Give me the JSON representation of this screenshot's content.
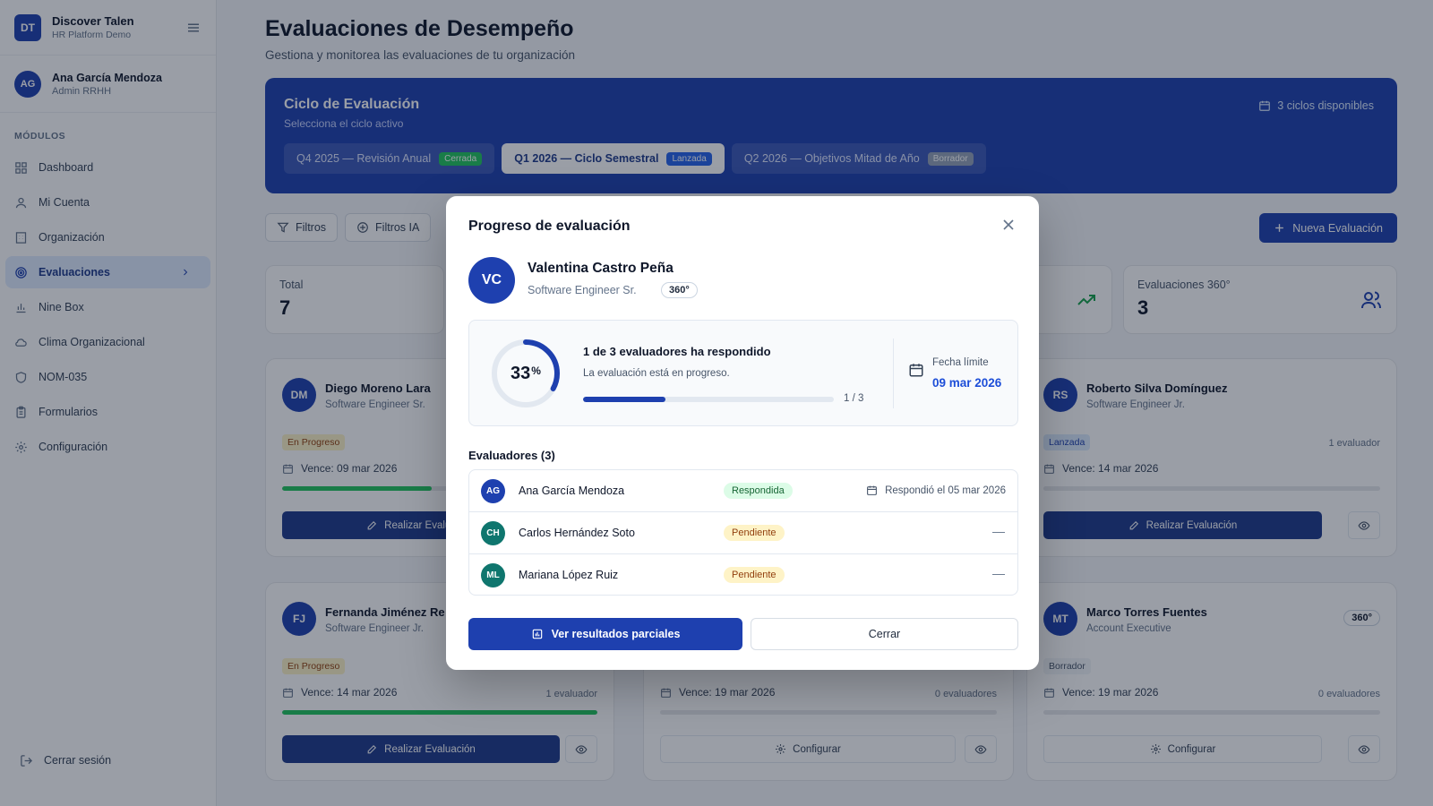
{
  "sidebar": {
    "brand_initials": "DT",
    "brand_name": "Discover Talen",
    "brand_sub": "HR Platform Demo",
    "user_initials": "AG",
    "user_name": "Ana García Mendoza",
    "user_role": "Admin RRHH",
    "modules_title": "MÓDULOS",
    "items": [
      {
        "label": "Dashboard",
        "icon": "dashboard-icon"
      },
      {
        "label": "Mi Cuenta",
        "icon": "user-icon"
      },
      {
        "label": "Organización",
        "icon": "building-icon"
      },
      {
        "label": "Evaluaciones",
        "icon": "target-icon",
        "active": true
      },
      {
        "label": "Nine Box",
        "icon": "bar-chart-icon"
      },
      {
        "label": "Clima Organizacional",
        "icon": "cloud-icon"
      },
      {
        "label": "NOM-035",
        "icon": "shield-icon"
      },
      {
        "label": "Formularios",
        "icon": "clipboard-icon"
      },
      {
        "label": "Configuración",
        "icon": "gear-icon"
      }
    ],
    "logout": "Cerrar sesión"
  },
  "page": {
    "title": "Evaluaciones de Desempeño",
    "subtitle": "Gestiona y monitorea las evaluaciones de tu organización"
  },
  "cycle": {
    "title": "Ciclo de Evaluación",
    "subtitle": "Selecciona el ciclo activo",
    "count": "3 ciclos disponibles",
    "tabs": [
      {
        "label": "Q4 2025 — Revisión Anual",
        "tag": "Cerrada"
      },
      {
        "label": "Q1 2026 — Ciclo Semestral",
        "tag": "Lanzada"
      },
      {
        "label": "Q2 2026 — Objetivos Mitad de Año",
        "tag": "Borrador"
      }
    ]
  },
  "toolbar": {
    "filters": "Filtros",
    "ai_filters": "Filtros IA",
    "new_eval": "Nueva Evaluación"
  },
  "stats": {
    "total_label": "Total",
    "total_value": "7",
    "e360_label": "Evaluaciones 360°",
    "e360_value": "3"
  },
  "cards": [
    {
      "initials": "DM",
      "name": "Diego Moreno Lara",
      "role": "Software Engineer Sr.",
      "badge": "En Progreso",
      "due": "Vence: 09 mar 2026",
      "action": "Realizar Evaluación",
      "progress": 0.5
    },
    {
      "initials": "RS",
      "name": "Roberto Silva Domínguez",
      "role": "Software Engineer Jr.",
      "badge": "Lanzada",
      "evaluators": "1 evaluador",
      "due": "Vence: 14 mar 2026",
      "action": "Realizar Evaluación",
      "progress": 0
    },
    {
      "initials": "FJ",
      "name": "Fernanda Jiménez Re",
      "role": "Software Engineer Jr.",
      "badge": "En Progreso",
      "evaluators": "1 evaluador",
      "due": "Vence: 14 mar 2026",
      "action": "Realizar Evaluación",
      "progress": 1
    },
    {
      "evaluators": "0 evaluadores",
      "due": "Vence: 19 mar 2026",
      "action": "Configurar",
      "progress": 0
    },
    {
      "initials": "MT",
      "name": "Marco Torres Fuentes",
      "role": "Account Executive",
      "badge": "Borrador",
      "pill": "360°",
      "evaluators": "0 evaluadores",
      "due": "Vence: 19 mar 2026",
      "action": "Configurar",
      "progress": 0
    }
  ],
  "modal": {
    "title": "Progreso de evaluación",
    "initials": "VC",
    "name": "Valentina Castro Peña",
    "role": "Software Engineer Sr.",
    "pill": "360°",
    "percent": "33",
    "percent_sign": "%",
    "progress": 0.33,
    "responded_title": "1 de 3 evaluadores ha respondido",
    "status_text": "La evaluación está en progreso.",
    "count": "1 / 3",
    "deadline_label": "Fecha límite",
    "deadline": "09 mar 2026",
    "evaluators_title": "Evaluadores (3)",
    "evaluators": [
      {
        "initials": "AG",
        "name": "Ana García Mendoza",
        "status": "Respondida",
        "date": "Respondió el 05 mar 2026",
        "color": "#1e40af"
      },
      {
        "initials": "CH",
        "name": "Carlos Hernández Soto",
        "status": "Pendiente",
        "date": "—",
        "color": "#0f766e"
      },
      {
        "initials": "ML",
        "name": "Mariana López Ruiz",
        "status": "Pendiente",
        "date": "—",
        "color": "#0f766e"
      }
    ],
    "primary": "Ver resultados parciales",
    "secondary": "Cerrar"
  },
  "colors": {
    "accent": "#1e40af",
    "success": "#22c55e",
    "warning": "#fef3c7"
  }
}
